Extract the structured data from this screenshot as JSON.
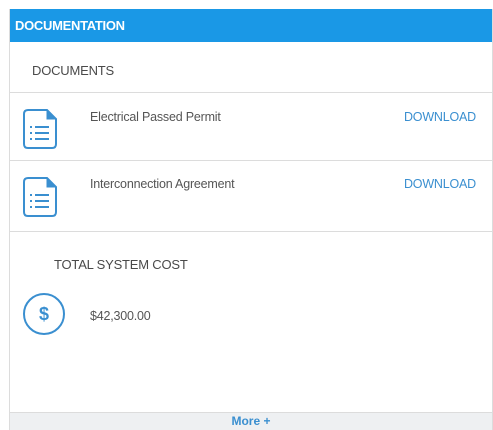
{
  "header": {
    "title": "DOCUMENTATION"
  },
  "documents": {
    "title": "DOCUMENTS",
    "items": [
      {
        "name": "Electrical Passed Permit",
        "action": "DOWNLOAD",
        "icon": "document-icon"
      },
      {
        "name": "Interconnection Agreement",
        "action": "DOWNLOAD",
        "icon": "document-icon"
      }
    ]
  },
  "cost": {
    "title": "TOTAL SYSTEM COST",
    "icon_symbol": "$",
    "icon": "dollar-icon",
    "value": "$42,300.00"
  },
  "footer": {
    "more_label": "More +"
  },
  "colors": {
    "header_bg": "#1a98e6",
    "accent": "#3a8fd0"
  }
}
